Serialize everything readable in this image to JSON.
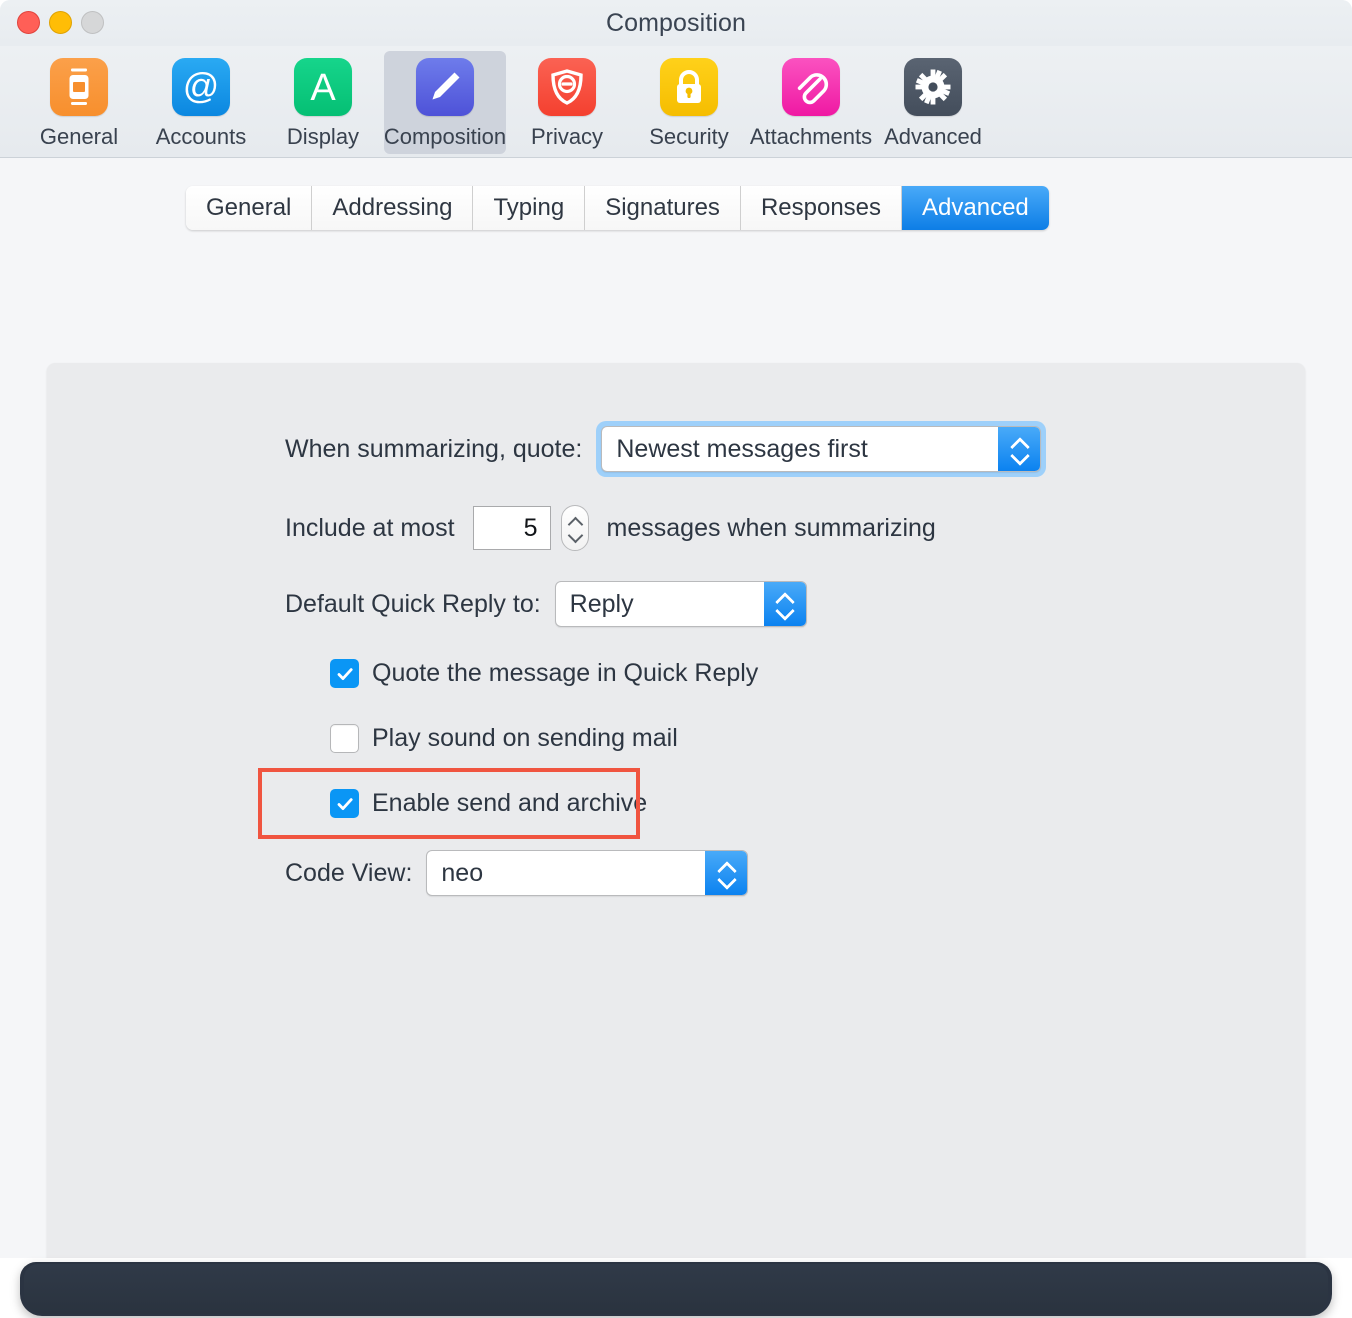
{
  "window": {
    "title": "Composition",
    "traffic_lights": [
      {
        "name": "close",
        "color": "#ff5f57"
      },
      {
        "name": "minimize",
        "color": "#ffbd06"
      },
      {
        "name": "zoom",
        "color": "#d6d7d8"
      }
    ]
  },
  "toolbar": {
    "items": [
      {
        "label": "General",
        "icon": "mobile-phone-icon",
        "color": "#f78f2d",
        "selected": false
      },
      {
        "label": "Accounts",
        "icon": "at-sign-icon",
        "color": "#0b87e0",
        "selected": false
      },
      {
        "label": "Display",
        "icon": "letter-a-icon",
        "color": "#05bf74",
        "selected": false
      },
      {
        "label": "Composition",
        "icon": "pencil-icon",
        "color": "#4e52d8",
        "selected": true
      },
      {
        "label": "Privacy",
        "icon": "shield-minus-icon",
        "color": "#f4402f",
        "selected": false
      },
      {
        "label": "Security",
        "icon": "padlock-icon",
        "color": "#f5bd00",
        "selected": false
      },
      {
        "label": "Attachments",
        "icon": "paperclip-icon",
        "color": "#ef19a3",
        "selected": false
      },
      {
        "label": "Advanced",
        "icon": "gear-icon",
        "color": "#434d5b",
        "selected": false
      }
    ]
  },
  "tabs": [
    {
      "label": "General",
      "active": false
    },
    {
      "label": "Addressing",
      "active": false
    },
    {
      "label": "Typing",
      "active": false
    },
    {
      "label": "Signatures",
      "active": false
    },
    {
      "label": "Responses",
      "active": false
    },
    {
      "label": "Advanced",
      "active": true
    }
  ],
  "settings": {
    "summarize_quote": {
      "label": "When summarizing, quote:",
      "value": "Newest messages first",
      "focused": true
    },
    "include_at_most": {
      "label_before": "Include at most",
      "value": "5",
      "label_after": "messages when summarizing"
    },
    "default_quick_reply": {
      "label": "Default Quick Reply to:",
      "value": "Reply"
    },
    "quote_in_quick_reply": {
      "label": "Quote the message in Quick Reply",
      "checked": true
    },
    "play_sound": {
      "label": "Play sound on sending mail",
      "checked": false
    },
    "enable_send_and_archive": {
      "label": "Enable send and archive",
      "checked": true,
      "highlighted": true
    },
    "code_view": {
      "label": "Code View:",
      "value": "neo"
    }
  },
  "annotation": {
    "name": "highlight-box-enable-send-and-archive",
    "color": "#f05440"
  }
}
